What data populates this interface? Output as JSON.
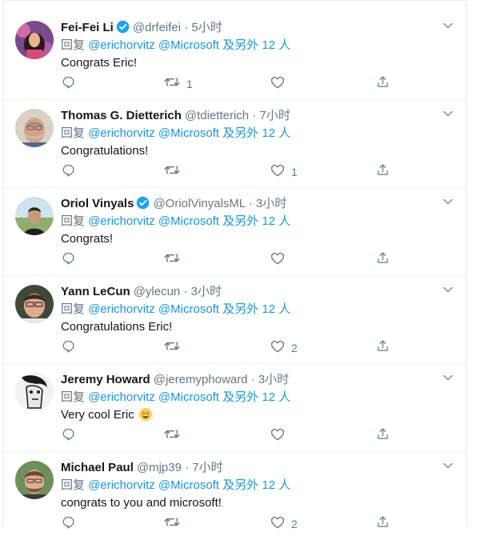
{
  "colors": {
    "accent": "#1b95e0",
    "meta": "#657786",
    "divider": "#e6ecf0",
    "verified": "#1da1f2"
  },
  "icons": {
    "reply": "reply-icon",
    "retweet": "retweet-icon",
    "like": "heart-icon",
    "share": "share-icon",
    "more": "chevron-down-icon",
    "verified": "verified-badge-icon"
  },
  "tweets": [
    {
      "name": "Fei-Fei Li",
      "handle": "@drfeifei",
      "time": "· 5小时",
      "reply_prefix": "回复",
      "mentions": "@erichorvitz @Microsoft",
      "reply_suffix": "及另外 12 人",
      "text": "Congrats Eric!",
      "retweets": "1",
      "likes": ""
    },
    {
      "name": "Thomas G. Dietterich",
      "handle": "@tdietterich",
      "time": "· 7小时",
      "reply_prefix": "回复",
      "mentions": "@erichorvitz @Microsoft",
      "reply_suffix": "及另外 12 人",
      "text": "Congratulations!",
      "retweets": "",
      "likes": "1"
    },
    {
      "name": "Oriol Vinyals",
      "handle": "@OriolVinyalsML",
      "time": "· 3小时",
      "reply_prefix": "回复",
      "mentions": "@erichorvitz @Microsoft",
      "reply_suffix": "及另外 12 人",
      "text": "Congrats!",
      "retweets": "",
      "likes": ""
    },
    {
      "name": "Yann LeCun",
      "handle": "@ylecun",
      "time": "· 3小时",
      "reply_prefix": "回复",
      "mentions": "@erichorvitz @Microsoft",
      "reply_suffix": "及另外 12 人",
      "text": "Congratulations Eric!",
      "retweets": "",
      "likes": "2"
    },
    {
      "name": "Jeremy Howard",
      "handle": "@jeremyphoward",
      "time": "· 3小时",
      "reply_prefix": "回复",
      "mentions": "@erichorvitz @Microsoft",
      "reply_suffix": "及另外 12 人",
      "text": "Very cool Eric",
      "retweets": "",
      "likes": ""
    },
    {
      "name": "Michael Paul",
      "handle": "@mjp39",
      "time": "· 7小时",
      "reply_prefix": "回复",
      "mentions": "@erichorvitz @Microsoft",
      "reply_suffix": "及另外 12 人",
      "text": "congrats to you and microsoft!",
      "retweets": "",
      "likes": "2"
    }
  ]
}
